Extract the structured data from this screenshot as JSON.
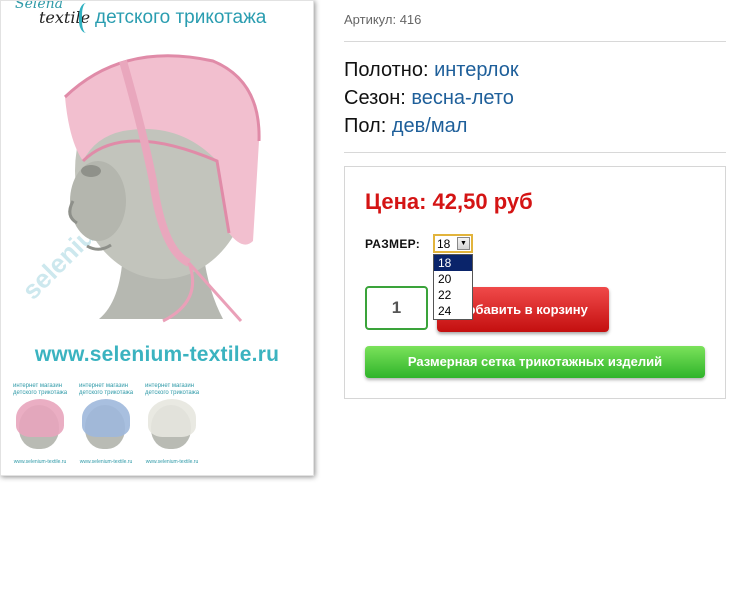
{
  "image": {
    "brand_script": "Selena",
    "brand_script2": "textile",
    "brand_line": "детского трикотажа",
    "url": "www.selenium-textile.ru",
    "watermark": "selenium-textile.ru",
    "thumbnails": [
      {
        "top": "интернет магазин детского трикотажа",
        "url": "www.selenium-textile.ru",
        "cap_color": "#e8a5bc"
      },
      {
        "top": "интернет магазин детского трикотажа",
        "url": "www.selenium-textile.ru",
        "cap_color": "#9fb8dc"
      },
      {
        "top": "интернет магазин детского трикотажа",
        "url": "www.selenium-textile.ru",
        "cap_color": "#e7e7df"
      }
    ]
  },
  "product": {
    "sku": "Артикул: 416",
    "fabric_label": "Полотно:",
    "fabric_value": "интерлок",
    "season_label": "Сезон:",
    "season_value": "весна-лето",
    "gender_label": "Пол:",
    "gender_value": "дев/мал"
  },
  "buy": {
    "price": "Цена: 42,50 руб",
    "size_label": "РАЗМЕР:",
    "size_selected": "18",
    "size_options": [
      "18",
      "20",
      "22",
      "24"
    ],
    "quantity": "1",
    "cart_button": "Добавить в корзину",
    "size_chart_button": "Размерная сетка трикотажных изделий"
  },
  "colors": {
    "price": "#d41414",
    "link": "#1e5f9a",
    "cart_button": "#d41414",
    "size_chart_button": "#3cc032",
    "dropdown_highlight": "#0a246a"
  }
}
